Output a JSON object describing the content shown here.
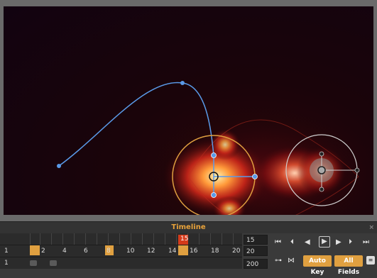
{
  "timeline": {
    "title": "Timeline",
    "close_glyph": "×",
    "current_frame_label": "15",
    "frame_labels": [
      "2",
      "4",
      "6",
      "8",
      "10",
      "12",
      "14",
      "16",
      "18",
      "20"
    ],
    "row_start": "1",
    "row_start2": "1",
    "field_current": "15",
    "field_end": "20",
    "field_total": "200"
  },
  "controls": {
    "auto_key": "Auto Key",
    "all_fields": "All Fields"
  },
  "icons": [
    "go-start-icon",
    "prev-key-icon",
    "step-back-icon",
    "play-icon",
    "step-forward-icon",
    "next-key-icon",
    "go-end-icon",
    "key-icon",
    "link-icon",
    "menu-icon"
  ],
  "colors": {
    "accent": "#e0a040",
    "current": "#d43a1a",
    "path": "#4a90e0",
    "gizmo": "#e0a040"
  }
}
